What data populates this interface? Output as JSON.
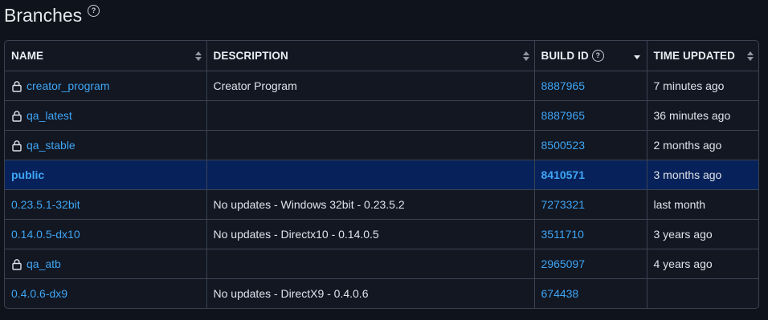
{
  "title": "Branches",
  "columns": {
    "name": "NAME",
    "description": "DESCRIPTION",
    "build_id": "BUILD ID",
    "time_updated": "TIME UPDATED"
  },
  "rows": [
    {
      "name": "creator_program",
      "locked": true,
      "description": "Creator Program",
      "build_id": "8887965",
      "time_updated": "7 minutes ago"
    },
    {
      "name": "qa_latest",
      "locked": true,
      "description": "",
      "build_id": "8887965",
      "time_updated": "36 minutes ago"
    },
    {
      "name": "qa_stable",
      "locked": true,
      "description": "",
      "build_id": "8500523",
      "time_updated": "2 months ago"
    },
    {
      "name": "public",
      "locked": false,
      "description": "",
      "build_id": "8410571",
      "time_updated": "3 months ago",
      "highlighted": true
    },
    {
      "name": "0.23.5.1-32bit",
      "locked": false,
      "description": "No updates - Windows 32bit - 0.23.5.2",
      "build_id": "7273321",
      "time_updated": "last month"
    },
    {
      "name": "0.14.0.5-dx10",
      "locked": false,
      "description": "No updates - Directx10 - 0.14.0.5",
      "build_id": "3511710",
      "time_updated": "3 years ago"
    },
    {
      "name": "qa_atb",
      "locked": true,
      "description": "",
      "build_id": "2965097",
      "time_updated": "4 years ago"
    },
    {
      "name": "0.4.0.6-dx9",
      "locked": false,
      "description": "No updates - DirectX9 - 0.4.0.6",
      "build_id": "674438",
      "time_updated": ""
    }
  ],
  "icons": {
    "title_help": "help-circle-icon",
    "build_help": "help-circle-icon",
    "lock": "lock-icon"
  },
  "colors": {
    "link": "#3fa5f5",
    "highlight_row": "#07225a",
    "border": "#3b4352",
    "background": "#0f131b"
  }
}
